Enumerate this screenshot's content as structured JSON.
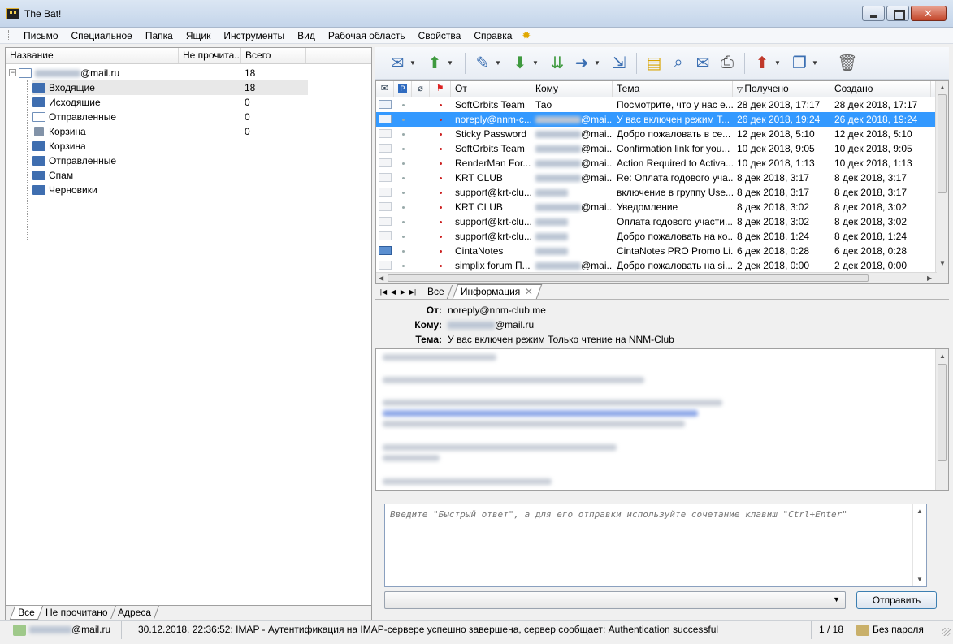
{
  "window": {
    "title": "The Bat!"
  },
  "menu": [
    "Письмо",
    "Специальное",
    "Папка",
    "Ящик",
    "Инструменты",
    "Вид",
    "Рабочая область",
    "Свойства",
    "Справка"
  ],
  "folder_tree": {
    "headers": {
      "name": "Название",
      "unread": "Не прочита...",
      "total": "Всего"
    },
    "account": {
      "name_suffix": "@mail.ru",
      "total": "18"
    },
    "folders": [
      {
        "name": "Входящие",
        "count": "18",
        "icon": "inbox-icon",
        "selected": true
      },
      {
        "name": "Исходящие",
        "count": "0",
        "icon": "outbox-icon"
      },
      {
        "name": "Отправленные",
        "count": "0",
        "icon": "sent-icon"
      },
      {
        "name": "Корзина",
        "count": "0",
        "icon": "trash-icon"
      },
      {
        "name": "Корзина",
        "count": "",
        "icon": "folder-icon"
      },
      {
        "name": "Отправленные",
        "count": "",
        "icon": "folder-icon"
      },
      {
        "name": "Спам",
        "count": "",
        "icon": "folder-icon"
      },
      {
        "name": "Черновики",
        "count": "",
        "icon": "folder-icon"
      }
    ],
    "tabs": [
      "Все",
      "Не прочитано",
      "Адреса"
    ]
  },
  "message_list": {
    "headers": {
      "from": "От",
      "to": "Кому",
      "subject": "Тема",
      "received": "Получено",
      "created": "Создано"
    },
    "rows": [
      {
        "from": "SoftOrbits Team",
        "to": "Тао",
        "to_blur": false,
        "subject": "Посмотрите, что у нас е...",
        "received": "28 дек 2018, 17:17",
        "created": "28 дек 2018, 17:17",
        "icon": "env"
      },
      {
        "from": "noreply@nnm-c...",
        "to": "@mai...",
        "to_blur": true,
        "subject": "У вас включен режим Т...",
        "received": "26 дек 2018, 19:24",
        "created": "26 дек 2018, 19:24",
        "icon": "env",
        "selected": true
      },
      {
        "from": "Sticky Password",
        "to": "@mai...",
        "to_blur": true,
        "subject": "Добро пожаловать в се...",
        "received": "12 дек 2018, 5:10",
        "created": "12 дек 2018, 5:10",
        "icon": "read"
      },
      {
        "from": "SoftOrbits Team",
        "to": "@mai...",
        "to_blur": true,
        "subject": "Confirmation link for you...",
        "received": "10 дек 2018, 9:05",
        "created": "10 дек 2018, 9:05",
        "icon": "read"
      },
      {
        "from": "RenderMan For...",
        "to": "@mai...",
        "to_blur": true,
        "subject": "Action Required to Activa...",
        "received": "10 дек 2018, 1:13",
        "created": "10 дек 2018, 1:13",
        "icon": "read"
      },
      {
        "from": "KRT CLUB",
        "to": "@mai...",
        "to_blur": true,
        "subject": "Re: Оплата годового уча...",
        "received": "8 дек 2018, 3:17",
        "created": "8 дек 2018, 3:17",
        "icon": "read"
      },
      {
        "from": "support@krt-clu...",
        "to": "",
        "to_blur": true,
        "subject": "включение в группу Use...",
        "received": "8 дек 2018, 3:17",
        "created": "8 дек 2018, 3:17",
        "icon": "read"
      },
      {
        "from": "KRT CLUB",
        "to": "@mai...",
        "to_blur": true,
        "subject": "Уведомление",
        "received": "8 дек 2018, 3:02",
        "created": "8 дек 2018, 3:02",
        "icon": "read"
      },
      {
        "from": "support@krt-clu...",
        "to": "",
        "to_blur": true,
        "subject": "Оплата годового участи...",
        "received": "8 дек 2018, 3:02",
        "created": "8 дек 2018, 3:02",
        "icon": "read"
      },
      {
        "from": "support@krt-clu...",
        "to": "",
        "to_blur": true,
        "subject": "Добро пожаловать на ко...",
        "received": "8 дек 2018, 1:24",
        "created": "8 дек 2018, 1:24",
        "icon": "read"
      },
      {
        "from": "CintaNotes",
        "to": "",
        "to_blur": true,
        "subject": "CintaNotes PRO Promo Li...",
        "received": "6 дек 2018, 0:28",
        "created": "6 дек 2018, 0:28",
        "icon": "blue"
      },
      {
        "from": "simplix forum П...",
        "to": "@mai...",
        "to_blur": true,
        "subject": "Добро пожаловать на si...",
        "received": "2 дек 2018, 0:00",
        "created": "2 дек 2018, 0:00",
        "icon": "read"
      }
    ]
  },
  "viewer": {
    "tabs": [
      "Все",
      "Информация"
    ],
    "from_label": "От:",
    "from_value": "noreply@nnm-club.me",
    "to_label": "Кому:",
    "to_value": "@mail.ru",
    "subject_label": "Тема:",
    "subject_value": "У вас включен режим Только чтение на NNM-Club"
  },
  "quick_reply": {
    "placeholder": "Введите \"Быстрый ответ\", а для его отправки используйте сочетание клавиш \"Ctrl+Enter\"",
    "send_label": "Отправить"
  },
  "status": {
    "account": "@mail.ru",
    "message": "30.12.2018, 22:36:52: IMAP  - Аутентификация на IMAP-сервере успешно завершена, сервер сообщает: Authentication successful",
    "position": "1 / 18",
    "password": "Без пароля"
  },
  "colors": {
    "selection": "#3399ff",
    "accent": "#3b6fb2"
  }
}
